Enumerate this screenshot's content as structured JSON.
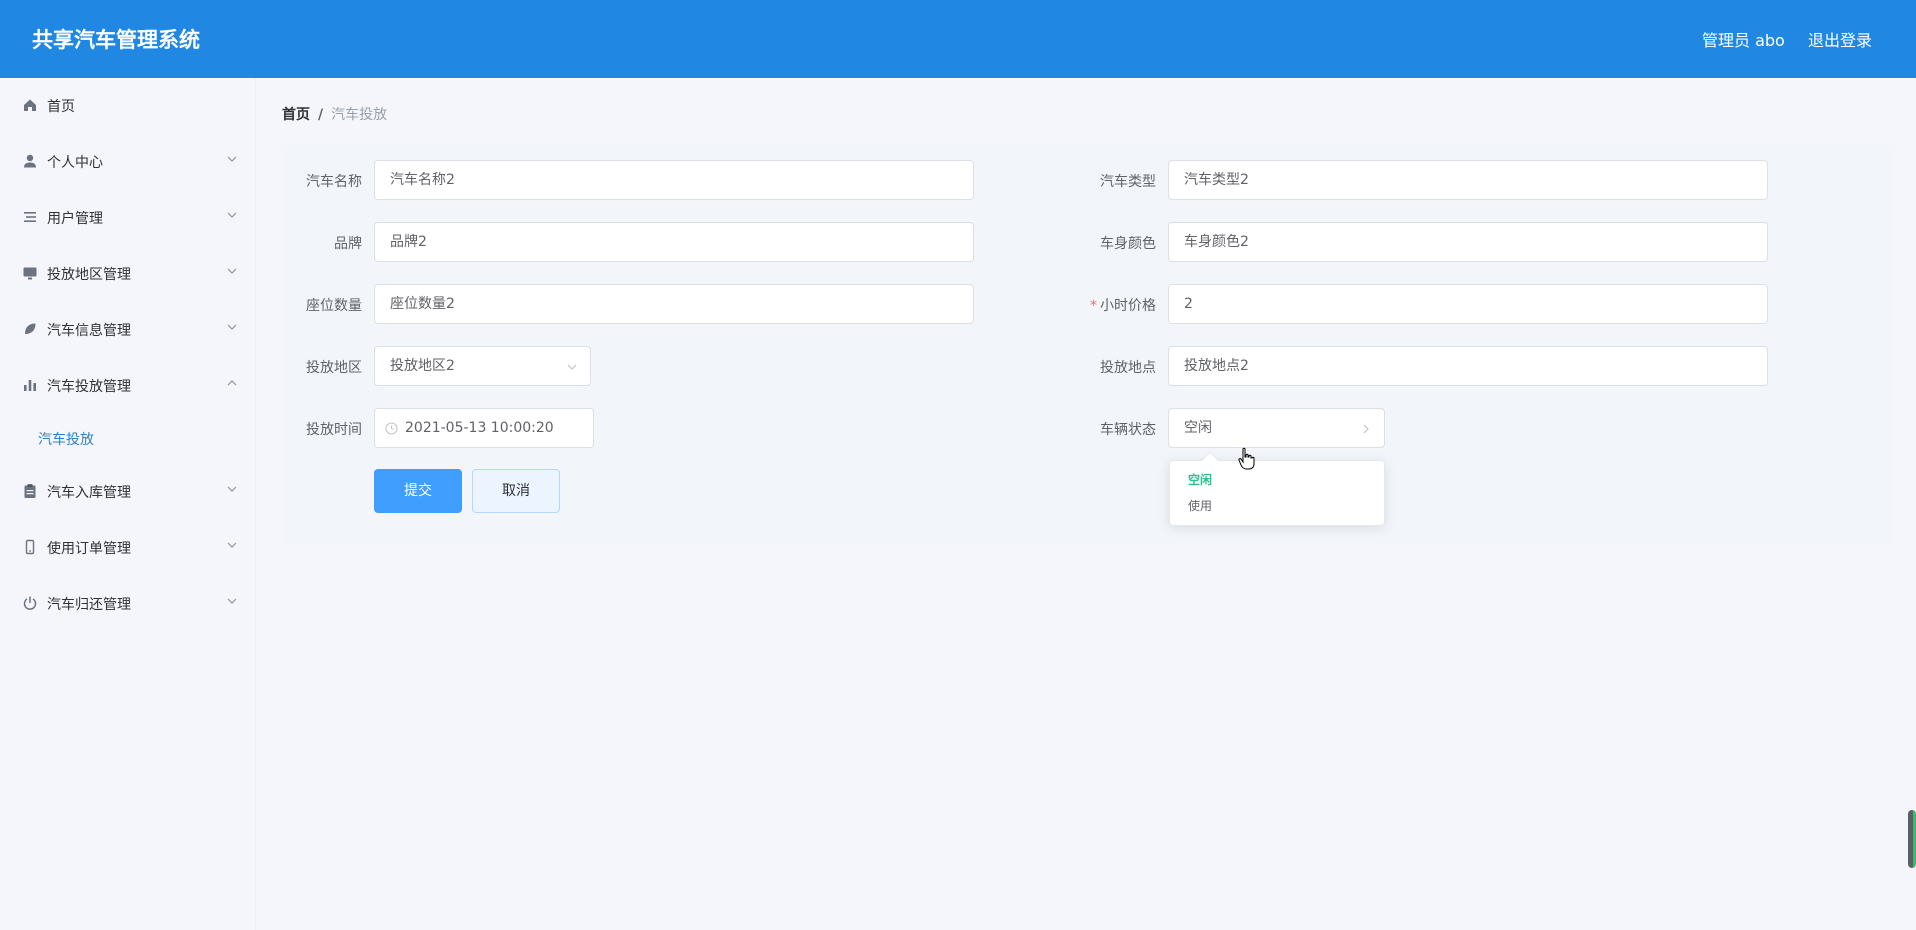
{
  "header": {
    "title": "共享汽车管理系统",
    "user": "管理员 abo",
    "logout": "退出登录"
  },
  "sidebar": {
    "items": [
      {
        "label": "首页",
        "icon": "home-icon"
      },
      {
        "label": "个人中心",
        "icon": "user-icon"
      },
      {
        "label": "用户管理",
        "icon": "list-icon"
      },
      {
        "label": "投放地区管理",
        "icon": "monitor-icon"
      },
      {
        "label": "汽车信息管理",
        "icon": "leaf-icon"
      },
      {
        "label": "汽车投放管理",
        "icon": "chart-icon"
      },
      {
        "label": "汽车入库管理",
        "icon": "clipboard-icon"
      },
      {
        "label": "使用订单管理",
        "icon": "phone-icon"
      },
      {
        "label": "汽车归还管理",
        "icon": "power-icon"
      }
    ],
    "subitems": [
      {
        "label": "汽车投放"
      }
    ]
  },
  "breadcrumb": {
    "home": "首页",
    "separator": "/",
    "current": "汽车投放"
  },
  "form": {
    "car_name": {
      "label": "汽车名称",
      "value": "汽车名称2"
    },
    "car_type": {
      "label": "汽车类型",
      "value": "汽车类型2"
    },
    "brand": {
      "label": "品牌",
      "value": "品牌2"
    },
    "body_color": {
      "label": "车身颜色",
      "value": "车身颜色2"
    },
    "seats": {
      "label": "座位数量",
      "value": "座位数量2"
    },
    "hourly_price": {
      "label": "小时价格",
      "value": "2",
      "required_mark": "*"
    },
    "region": {
      "label": "投放地区",
      "value": "投放地区2"
    },
    "location": {
      "label": "投放地点",
      "value": "投放地点2"
    },
    "time": {
      "label": "投放时间",
      "value": "2021-05-13 10:00:20"
    },
    "status": {
      "label": "车辆状态",
      "value": "空闲"
    },
    "submit": "提交",
    "cancel": "取消"
  },
  "status_dropdown": {
    "options": [
      "空闲",
      "使用"
    ],
    "selected": "空闲"
  },
  "colors": {
    "header_bg": "#2088e2",
    "primary": "#409eff",
    "active_menu": "#2f82c9",
    "selected_option": "#2fbe8e"
  }
}
